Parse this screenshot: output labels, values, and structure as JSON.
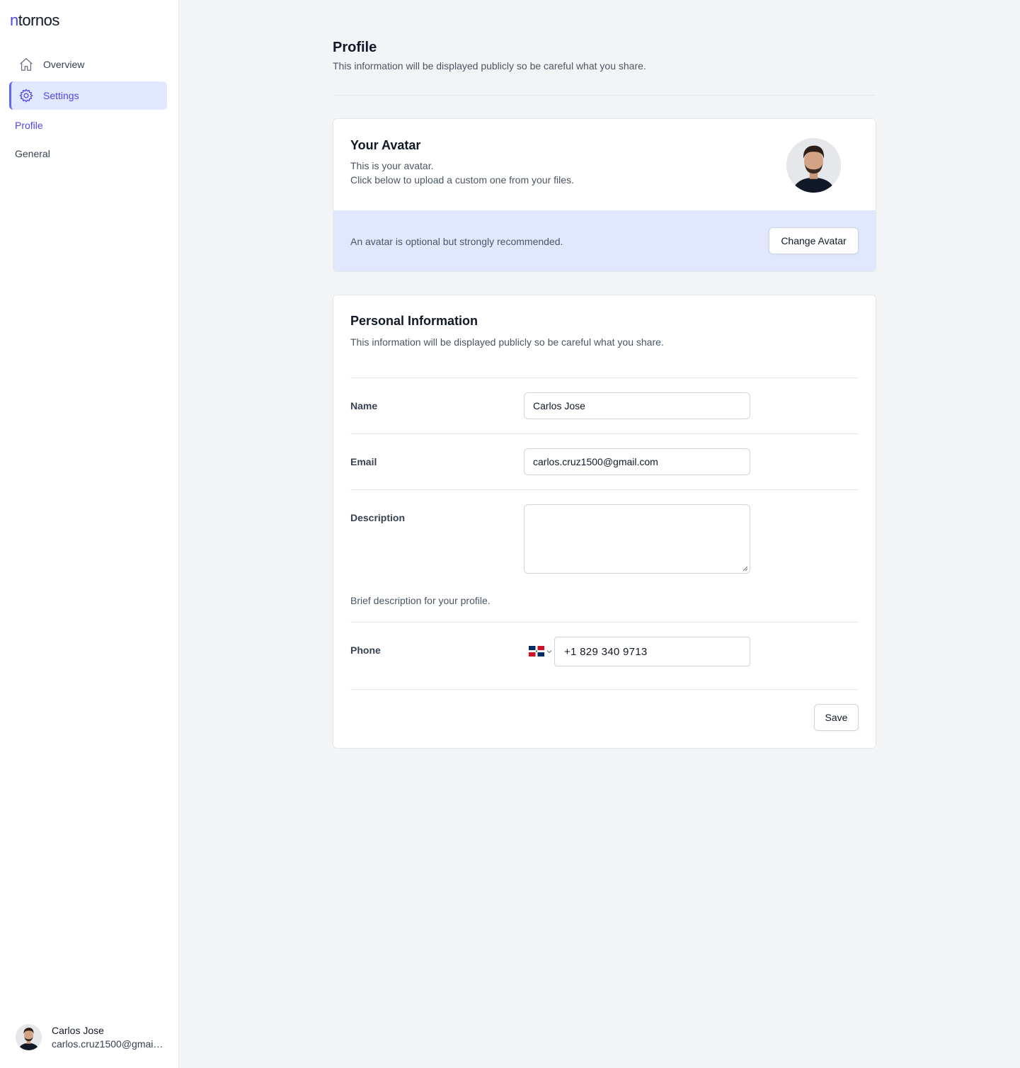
{
  "brand": {
    "prefix": "n",
    "rest": "tornos",
    "accent_color": "#4f46e5"
  },
  "sidebar": {
    "nav": [
      {
        "label": "Overview",
        "icon": "home-icon",
        "active": false
      },
      {
        "label": "Settings",
        "icon": "gear-icon",
        "active": true
      }
    ],
    "sub_items": [
      {
        "label": "Profile",
        "active": true
      },
      {
        "label": "General",
        "active": false
      }
    ],
    "user": {
      "name": "Carlos Jose",
      "email": "carlos.cruz1500@gmail.com"
    }
  },
  "header": {
    "title": "Profile",
    "subtitle": "This information will be displayed publicly so be careful what you share."
  },
  "avatar_card": {
    "title": "Your Avatar",
    "line1": "This is your avatar.",
    "line2": "Click below to upload a custom one from your files.",
    "footer_note": "An avatar is optional but strongly recommended.",
    "button_label": "Change Avatar"
  },
  "personal_card": {
    "title": "Personal Information",
    "subtitle": "This information will be displayed publicly so be careful what you share.",
    "fields": {
      "name": {
        "label": "Name",
        "value": "Carlos Jose"
      },
      "email": {
        "label": "Email",
        "value": "carlos.cruz1500@gmail.com"
      },
      "description": {
        "label": "Description",
        "value": "",
        "hint": "Brief description for your profile."
      },
      "phone": {
        "label": "Phone",
        "value": "+1 829 340 9713",
        "country_flag": "dominican-republic-flag-icon"
      }
    },
    "save_label": "Save"
  }
}
